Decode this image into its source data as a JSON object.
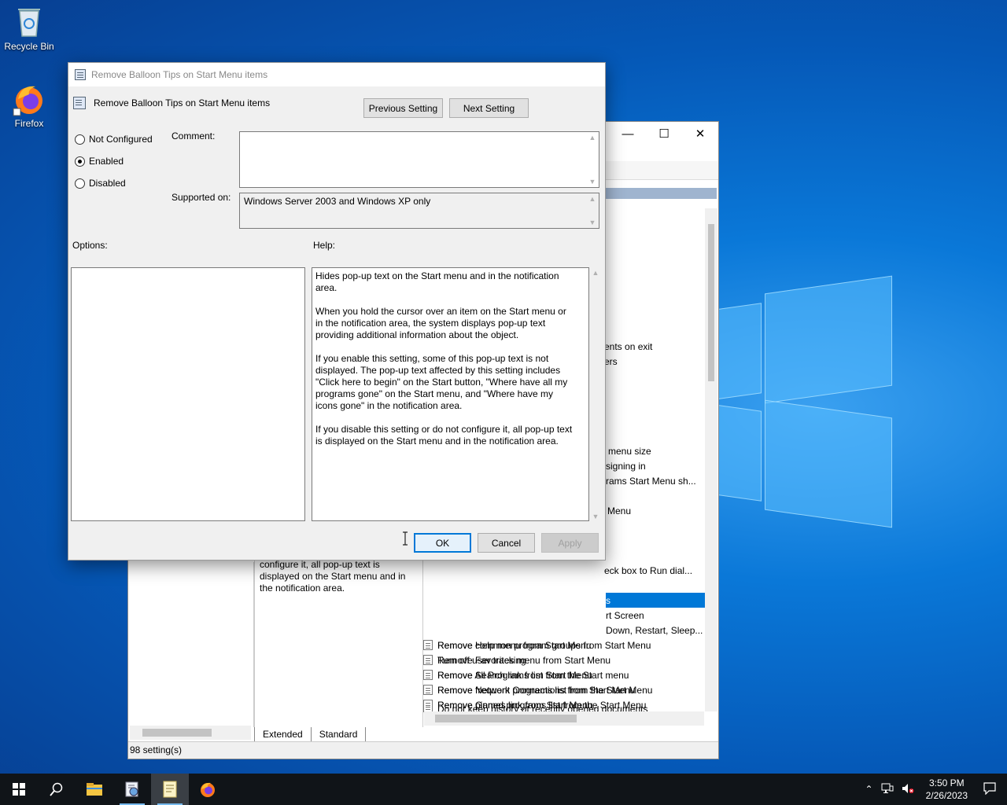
{
  "desktop": {
    "icons": [
      {
        "label": "Recycle Bin",
        "icon": "recycle-bin-icon"
      },
      {
        "label": "Firefox",
        "icon": "firefox-icon"
      }
    ]
  },
  "bg_window": {
    "settings": [
      "ents on exit",
      "ers",
      "menu size",
      "signing in",
      "rams Start Menu sh...",
      "Menu",
      "eck box to Run dial...",
      "s",
      "rt Screen",
      "Down, Restart, Sleep...",
      "Remove common program groups from Start Menu",
      "Remove Favorites menu from Start Menu",
      "Remove Search link from Start Menu",
      "Remove frequent programs list from the Start Menu",
      "Remove Games link from Start Menu",
      "Remove Help menu from Start Menu",
      "Turn off user tracking",
      "Remove All Programs list from the Start menu",
      "Remove Network Connections from Start Menu",
      "Remove pinned programs list from the Start Menu",
      "Do not keep history of recently opened documents"
    ],
    "description_fragment": "configure it, all pop-up text is displayed on the Start menu and in the notification area.",
    "tabs": [
      "Extended",
      "Standard"
    ],
    "status": "98 setting(s)",
    "caption_icons": [
      "minimize-icon",
      "maximize-icon",
      "close-icon"
    ]
  },
  "dialog": {
    "window_title": "Remove Balloon Tips on Start Menu items",
    "setting_name": "Remove Balloon Tips on Start Menu items",
    "previous_label": "Previous Setting",
    "next_label": "Next Setting",
    "radio_not_configured": "Not Configured",
    "radio_enabled": "Enabled",
    "radio_disabled": "Disabled",
    "selected_state": "Enabled",
    "comment_label": "Comment:",
    "comment_value": "",
    "supported_label": "Supported on:",
    "supported_value": "Windows Server 2003 and Windows XP only",
    "options_label": "Options:",
    "help_label": "Help:",
    "help_paragraphs": [
      "Hides pop-up text on the Start menu and in the notification area.",
      "When you hold the cursor over an item on the Start menu or in the notification area, the system displays pop-up text providing additional information about the object.",
      "If you enable this setting, some of this pop-up text is not displayed. The pop-up text affected by this setting includes \"Click here to begin\" on the Start button, \"Where have all my programs gone\" on the Start menu, and \"Where have my icons gone\" in the notification area.",
      "If you disable this setting or do not configure it, all pop-up text is displayed on the Start menu and in the notification area."
    ],
    "ok_label": "OK",
    "cancel_label": "Cancel",
    "apply_label": "Apply"
  },
  "taskbar": {
    "apps": [
      "start-icon",
      "search-icon",
      "file-explorer-icon",
      "group-policy-icon",
      "notepad-icon",
      "firefox-icon"
    ],
    "time": "3:50 PM",
    "date": "2/26/2023"
  }
}
